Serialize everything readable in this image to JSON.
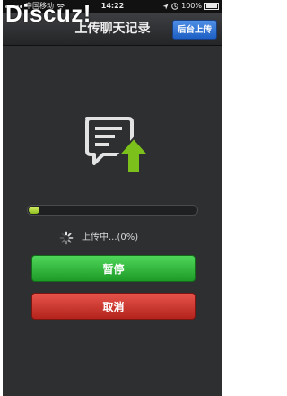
{
  "status_bar": {
    "carrier": "中国移动",
    "time": "14:22",
    "battery": "100%"
  },
  "watermark": "Discuz!",
  "nav": {
    "title": "上传聊天记录",
    "upload_background_label": "后台上传"
  },
  "upload": {
    "status_text": "上传中...(0%)",
    "progress": 0
  },
  "buttons": {
    "pause_label": "暂停",
    "cancel_label": "取消"
  },
  "colors": {
    "background": "#2e2f31",
    "pause_button": "#2fb838",
    "cancel_button": "#cc3a31",
    "nav_button": "#2f6fd0",
    "progress": "#b5dc3a",
    "upload_arrow": "#7cc11b"
  },
  "icons": {
    "illustration": "chat-upload-icon",
    "spinner": "loading-spinner-icon"
  }
}
